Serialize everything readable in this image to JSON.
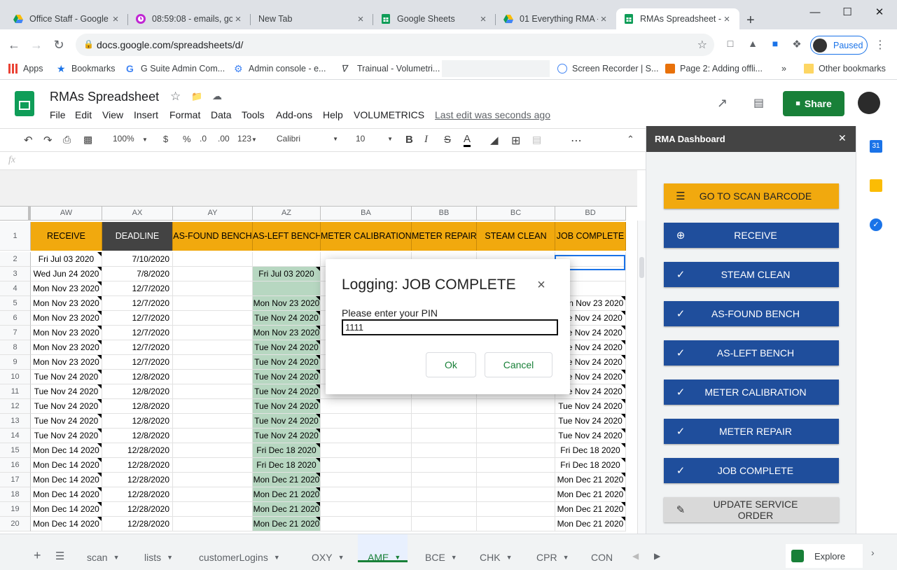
{
  "browser": {
    "tabs": [
      {
        "title": "Office Staff - Google",
        "icon": "google-drive-icon"
      },
      {
        "title": "08:59:08 - emails, go",
        "icon": "clock-icon"
      },
      {
        "title": "New Tab",
        "icon": ""
      },
      {
        "title": "Google Sheets",
        "icon": "sheets-icon"
      },
      {
        "title": "01 Everything RMA -",
        "icon": "google-drive-icon"
      },
      {
        "title": "RMAs Spreadsheet -",
        "icon": "sheets-icon"
      }
    ],
    "new_tab": "+",
    "url": "docs.google.com/spreadsheets/d/",
    "profile_label": "Paused",
    "bookmarks": [
      {
        "label": "Apps"
      },
      {
        "label": "Bookmarks"
      },
      {
        "label": "G Suite Admin Com..."
      },
      {
        "label": "Admin console - e..."
      },
      {
        "label": "Trainual - Volumetri..."
      },
      {
        "label": "Screen Recorder | S..."
      },
      {
        "label": "Page 2: Adding offli..."
      }
    ],
    "bookmarks_more": "»",
    "other_bookmarks": "Other bookmarks"
  },
  "sheets": {
    "doc_title": "RMAs Spreadsheet",
    "menus": [
      "File",
      "Edit",
      "View",
      "Insert",
      "Format",
      "Data",
      "Tools",
      "Add-ons",
      "Help",
      "VOLUMETRICS"
    ],
    "last_edit": "Last edit was seconds ago",
    "share_label": "Share",
    "toolbar": {
      "zoom": "100%",
      "currency": "$",
      "percent": "%",
      "dec_less": ".0",
      "dec_more": ".00",
      "num_format": "123",
      "font": "Calibri",
      "font_size": "10",
      "bold": "B",
      "italic": "I",
      "strike": "S",
      "text_color": "A",
      "more": "⋯"
    },
    "fx": "fx"
  },
  "grid": {
    "columns": [
      "AW",
      "AX",
      "AY",
      "AZ",
      "BA",
      "BB",
      "BC",
      "BD"
    ],
    "header_row": [
      "RECEIVE",
      "DEADLINE",
      "AS-FOUND BENCH",
      "AS-LEFT BENCH",
      "METER CALIBRATION",
      "METER REPAIR",
      "STEAM CLEAN",
      "JOB COMPLETE"
    ],
    "header_row_number": "1",
    "rows": [
      {
        "n": "2",
        "aw": "Fri Jul 03 2020",
        "ax": "7/10/2020",
        "az": "",
        "bd": ""
      },
      {
        "n": "3",
        "aw": "Wed Jun 24 2020",
        "ax": "7/8/2020",
        "az": "Fri Jul 03 2020",
        "bd": ""
      },
      {
        "n": "4",
        "aw": "Mon Nov 23 2020",
        "ax": "12/7/2020",
        "az": "",
        "bd": ""
      },
      {
        "n": "5",
        "aw": "Mon Nov 23 2020",
        "ax": "12/7/2020",
        "az": "Mon Nov 23 2020",
        "bd": "Mon Nov 23 2020"
      },
      {
        "n": "6",
        "aw": "Mon Nov 23 2020",
        "ax": "12/7/2020",
        "az": "Tue Nov 24 2020",
        "bd": "Tue Nov 24 2020"
      },
      {
        "n": "7",
        "aw": "Mon Nov 23 2020",
        "ax": "12/7/2020",
        "az": "Mon Nov 23 2020",
        "bd": "Tue Nov 24 2020"
      },
      {
        "n": "8",
        "aw": "Mon Nov 23 2020",
        "ax": "12/7/2020",
        "az": "Tue Nov 24 2020",
        "bd": "Tue Nov 24 2020"
      },
      {
        "n": "9",
        "aw": "Mon Nov 23 2020",
        "ax": "12/7/2020",
        "az": "Tue Nov 24 2020",
        "bd": "Tue Nov 24 2020"
      },
      {
        "n": "10",
        "aw": "Tue Nov 24 2020",
        "ax": "12/8/2020",
        "az": "Tue Nov 24 2020",
        "bd": "Tue Nov 24 2020"
      },
      {
        "n": "11",
        "aw": "Tue Nov 24 2020",
        "ax": "12/8/2020",
        "az": "Tue Nov 24 2020",
        "bd": "Tue Nov 24 2020"
      },
      {
        "n": "12",
        "aw": "Tue Nov 24 2020",
        "ax": "12/8/2020",
        "az": "Tue Nov 24 2020",
        "bd": "Tue Nov 24 2020"
      },
      {
        "n": "13",
        "aw": "Tue Nov 24 2020",
        "ax": "12/8/2020",
        "az": "Tue Nov 24 2020",
        "bd": "Tue Nov 24 2020"
      },
      {
        "n": "14",
        "aw": "Tue Nov 24 2020",
        "ax": "12/8/2020",
        "az": "Tue Nov 24 2020",
        "bd": "Tue Nov 24 2020"
      },
      {
        "n": "15",
        "aw": "Mon Dec 14 2020",
        "ax": "12/28/2020",
        "az": "Fri Dec 18 2020",
        "bd": "Fri Dec 18 2020"
      },
      {
        "n": "16",
        "aw": "Mon Dec 14 2020",
        "ax": "12/28/2020",
        "az": "Fri Dec 18 2020",
        "bd": "Fri Dec 18 2020"
      },
      {
        "n": "17",
        "aw": "Mon Dec 14 2020",
        "ax": "12/28/2020",
        "az": "Mon Dec 21 2020",
        "bd": "Mon Dec 21 2020"
      },
      {
        "n": "18",
        "aw": "Mon Dec 14 2020",
        "ax": "12/28/2020",
        "az": "Mon Dec 21 2020",
        "bd": "Mon Dec 21 2020"
      },
      {
        "n": "19",
        "aw": "Mon Dec 14 2020",
        "ax": "12/28/2020",
        "az": "Mon Dec 21 2020",
        "bd": "Mon Dec 21 2020"
      },
      {
        "n": "20",
        "aw": "Mon Dec 14 2020",
        "ax": "12/28/2020",
        "az": "Mon Dec 21 2020",
        "bd": "Mon Dec 21 2020"
      }
    ]
  },
  "sidebar": {
    "title": "RMA Dashboard",
    "close": "✕",
    "buttons": [
      {
        "label": "GO TO SCAN BARCODE",
        "icon": "barcode-icon",
        "style": "gold"
      },
      {
        "label": "RECEIVE",
        "icon": "add-circle-icon",
        "style": "blue"
      },
      {
        "label": "STEAM CLEAN",
        "icon": "check-icon",
        "style": "blue"
      },
      {
        "label": "AS-FOUND BENCH",
        "icon": "check-icon",
        "style": "blue"
      },
      {
        "label": "AS-LEFT BENCH",
        "icon": "check-icon",
        "style": "blue"
      },
      {
        "label": "METER CALIBRATION",
        "icon": "check-icon",
        "style": "blue"
      },
      {
        "label": "METER REPAIR",
        "icon": "check-icon",
        "style": "blue"
      },
      {
        "label": "JOB COMPLETE",
        "icon": "check-icon",
        "style": "blue"
      },
      {
        "label": "UPDATE SERVICE ORDER",
        "icon": "pencil-icon",
        "style": "grey"
      }
    ]
  },
  "sheet_tabs": {
    "add": "+",
    "tabs": [
      {
        "label": "scan",
        "active": false
      },
      {
        "label": "lists",
        "active": false
      },
      {
        "label": "customerLogins",
        "active": false
      },
      {
        "label": "OXY",
        "active": false
      },
      {
        "label": "AME",
        "active": true
      },
      {
        "label": "BCE",
        "active": false
      },
      {
        "label": "CHK",
        "active": false
      },
      {
        "label": "CPR",
        "active": false
      },
      {
        "label": "CON",
        "active": false
      }
    ],
    "explore": "Explore"
  },
  "modal": {
    "title": "Logging: JOB COMPLETE",
    "close": "×",
    "prompt": "Please enter your PIN",
    "pin_value": "1111",
    "ok_label": "Ok",
    "cancel_label": "Cancel"
  },
  "colors": {
    "header_gold": "#f1a90e",
    "header_dark": "#434343",
    "sidebar_blue": "#1f4e9c",
    "green_fill": "#b7d7c1",
    "share_green": "#188038"
  }
}
